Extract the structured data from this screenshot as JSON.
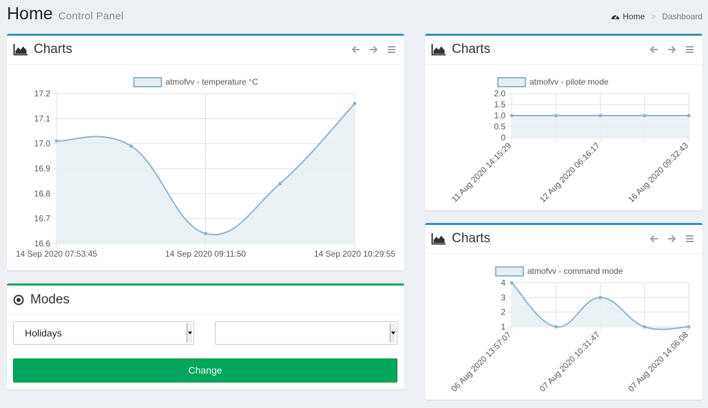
{
  "header": {
    "title": "Home",
    "subtitle": "Control Panel"
  },
  "breadcrumb": {
    "home_label": "Home",
    "separator": ">",
    "current": "Dashboard"
  },
  "colors": {
    "primary_border": "#3c8dbc",
    "success": "#00a65a",
    "series_line": "#8fb4cc",
    "series_fill": "#e6eef3",
    "grid": "#e2e2e2"
  },
  "panels": {
    "temperature": {
      "title": "Charts",
      "icon": "area-chart-icon"
    },
    "pilote": {
      "title": "Charts",
      "icon": "area-chart-icon"
    },
    "command": {
      "title": "Charts",
      "icon": "area-chart-icon"
    },
    "modes": {
      "title": "Modes",
      "icon": "dot-circle-icon",
      "select1_value": "Holidays",
      "select2_value": "",
      "button_label": "Change"
    }
  },
  "chart_data": [
    {
      "type": "line",
      "legend": "atmofvv - temperature °C",
      "x": [
        "14 Sep 2020 07:53:45",
        "",
        "14 Sep 2020 09:11:50",
        "",
        "14 Sep 2020 10:29:55"
      ],
      "y": [
        17.01,
        16.99,
        16.64,
        16.84,
        17.16
      ],
      "ylim": [
        16.6,
        17.2
      ],
      "yticks": [
        16.6,
        16.7,
        16.8,
        16.9,
        17.0,
        17.1,
        17.2
      ],
      "ytick_labels": [
        "16.6",
        "16.7",
        "16.8",
        "16.9",
        "17.0",
        "17.1",
        "17.2"
      ],
      "grid": true,
      "legend_position": "top"
    },
    {
      "type": "line",
      "legend": "atmofvv - pilote mode",
      "x": [
        "11 Aug 2020 14:15:29",
        "",
        "12 Aug 2020 06:16:17",
        "",
        "16 Aug 2020 09:32:43"
      ],
      "y": [
        1,
        1,
        1,
        1,
        1
      ],
      "ylim": [
        0,
        2
      ],
      "yticks": [
        0,
        0.5,
        1.0,
        1.5,
        2.0
      ],
      "ytick_labels": [
        "0",
        "0.5",
        "1.0",
        "1.5",
        "2.0"
      ],
      "grid": true,
      "legend_position": "top"
    },
    {
      "type": "line",
      "legend": "atmofvv - command mode",
      "x": [
        "06 Aug 2020 13:57:07",
        "",
        "07 Aug 2020 10:31:47",
        "",
        "07 Aug 2020 14:06:08"
      ],
      "y": [
        4,
        1,
        3,
        1,
        1
      ],
      "ylim": [
        1,
        4
      ],
      "yticks": [
        1,
        2,
        3,
        4
      ],
      "ytick_labels": [
        "1",
        "2",
        "3",
        "4"
      ],
      "grid": true,
      "legend_position": "top"
    }
  ]
}
